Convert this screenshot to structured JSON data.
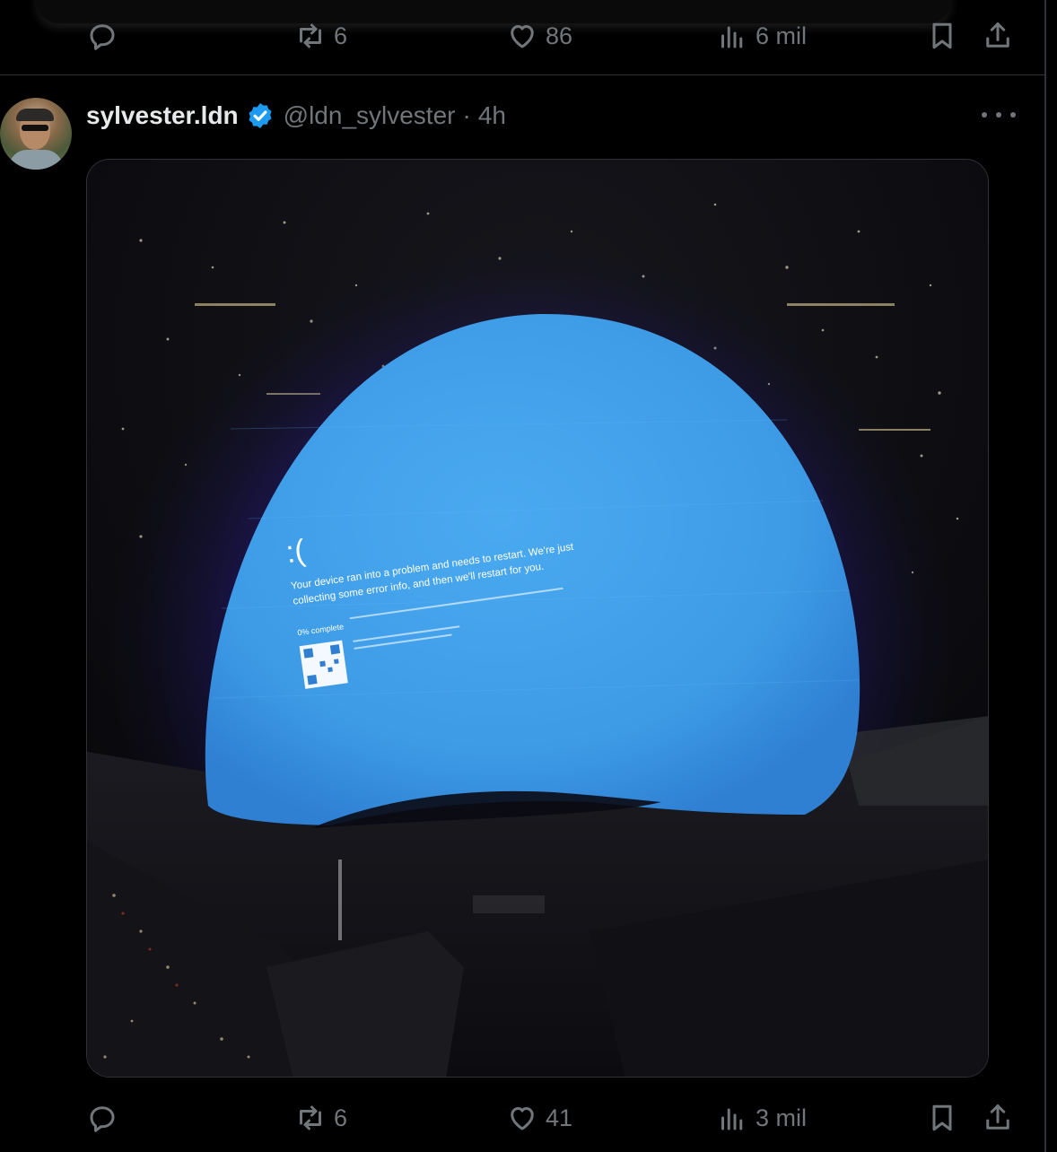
{
  "previous_tweet": {
    "actions": {
      "reply_count": "",
      "retweet_count": "6",
      "like_count": "86",
      "views_count": "6 mil"
    }
  },
  "tweet": {
    "author": {
      "display_name": "sylvester.ldn",
      "handle": "@ldn_sylvester",
      "verified": true
    },
    "separator": "·",
    "time": "4h",
    "media": {
      "screen_text": {
        "emoticon": ":(",
        "line1": "Your device ran into a problem and needs to restart. We're just",
        "line2": "collecting some error info, and then we'll restart for you.",
        "progress": "0% complete"
      }
    },
    "actions": {
      "reply_count": "",
      "retweet_count": "6",
      "like_count": "41",
      "views_count": "3 mil"
    }
  },
  "colors": {
    "background": "#000000",
    "text_primary": "#e7e9ea",
    "text_secondary": "#71767b",
    "verified_blue": "#1d9bf0",
    "divider": "#2f3336",
    "sphere_blue": "#3d9be6"
  }
}
